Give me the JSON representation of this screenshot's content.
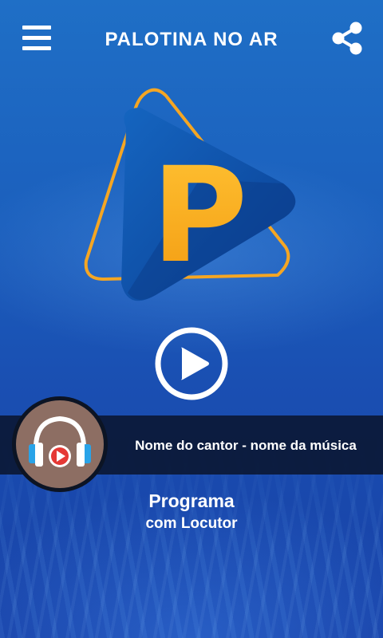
{
  "header": {
    "menu_icon": "hamburger-menu-icon",
    "title": "PALOTINA NO AR",
    "share_icon": "share-icon"
  },
  "logo": {
    "letter": "P",
    "icon": "play-triangle-logo"
  },
  "player": {
    "play_icon": "play-circle-icon"
  },
  "now_playing": {
    "song": "Nome do cantor - nome da música",
    "avatar_icon": "headphones-icon"
  },
  "program": {
    "name": "Programa",
    "host": "com Locutor"
  },
  "colors": {
    "background": "#1b5fbd",
    "logo_blue": "#0d4fa8",
    "logo_orange": "#f5a623",
    "bar": "#0a1630",
    "avatar": "#8d6e63",
    "headphone_red": "#e53935",
    "headphone_blue": "#29a3e8"
  }
}
